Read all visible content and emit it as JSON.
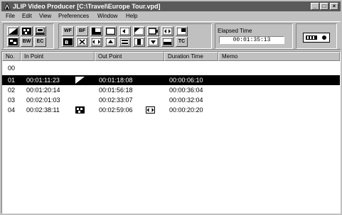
{
  "window": {
    "title": "JLIP Video Producer [C:\\Travel\\Europe Tour.vpd]",
    "controls": [
      "_",
      "□",
      "×"
    ]
  },
  "menu": [
    "File",
    "Edit",
    "View",
    "Preferences",
    "Window",
    "Help"
  ],
  "toolbar": {
    "wf_label": "WF",
    "bf_label": "BF",
    "bw_label": "BW",
    "ec_label": "EC",
    "tc_label": "TC"
  },
  "elapsed": {
    "label": "Elapsed Time",
    "value": "00:01:35:13"
  },
  "columns": [
    "No.",
    "In Point",
    "Out Point",
    "Duration Time",
    "Memo"
  ],
  "rows": [
    {
      "no": "00",
      "in": "",
      "out": "",
      "duration": "",
      "memo": "",
      "in_icon": "",
      "out_icon": ""
    },
    {
      "no": "01",
      "in": "00:01:11:23",
      "out": "00:01:18:08",
      "duration": "00:00:06:10",
      "memo": "",
      "in_icon": "wipe-icon",
      "out_icon": ""
    },
    {
      "no": "02",
      "in": "00:01:20:14",
      "out": "00:01:56:18",
      "duration": "00:00:36:04",
      "memo": "",
      "in_icon": "",
      "out_icon": ""
    },
    {
      "no": "03",
      "in": "00:02:01:03",
      "out": "00:02:33:07",
      "duration": "00:00:32:04",
      "memo": "",
      "in_icon": "",
      "out_icon": ""
    },
    {
      "no": "04",
      "in": "00:02:38:11",
      "out": "00:02:59:06",
      "duration": "00:00:20:20",
      "memo": "",
      "in_icon": "mosaic-icon",
      "out_icon": "slide-icon"
    }
  ]
}
